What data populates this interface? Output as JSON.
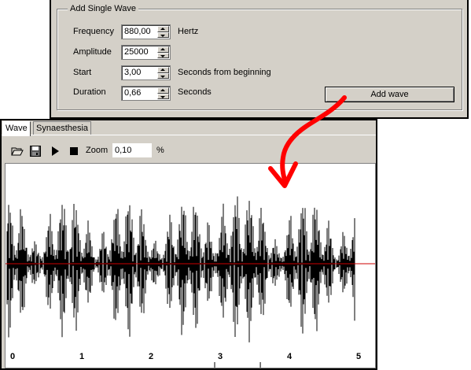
{
  "dialog": {
    "group_title": "Add Single Wave",
    "fields": [
      {
        "label": "Frequency",
        "value": "880,00",
        "unit": "Hertz"
      },
      {
        "label": "Amplitude",
        "value": "25000",
        "unit": ""
      },
      {
        "label": "Start",
        "value": "3,00",
        "unit": "Seconds from beginning"
      },
      {
        "label": "Duration",
        "value": "0,66",
        "unit": "Seconds"
      }
    ],
    "add_button_label": "Add wave"
  },
  "wave_window": {
    "tabs": [
      {
        "label": "Wave",
        "active": true
      },
      {
        "label": "Synaesthesia",
        "active": false
      }
    ],
    "toolbar": {
      "icons": [
        "open-folder-icon",
        "save-disk-icon",
        "play-icon",
        "stop-icon"
      ],
      "zoom_label": "Zoom",
      "zoom_value": "0,10",
      "zoom_unit": "%"
    },
    "time_axis": {
      "tick_labels": [
        "0",
        "1",
        "2",
        "3",
        "4",
        "5"
      ]
    }
  },
  "colors": {
    "dialog_bg": "#d4d0c8",
    "waveform": "#000000",
    "baseline": "#cc0000",
    "annotation_arrow": "#ff0000"
  }
}
